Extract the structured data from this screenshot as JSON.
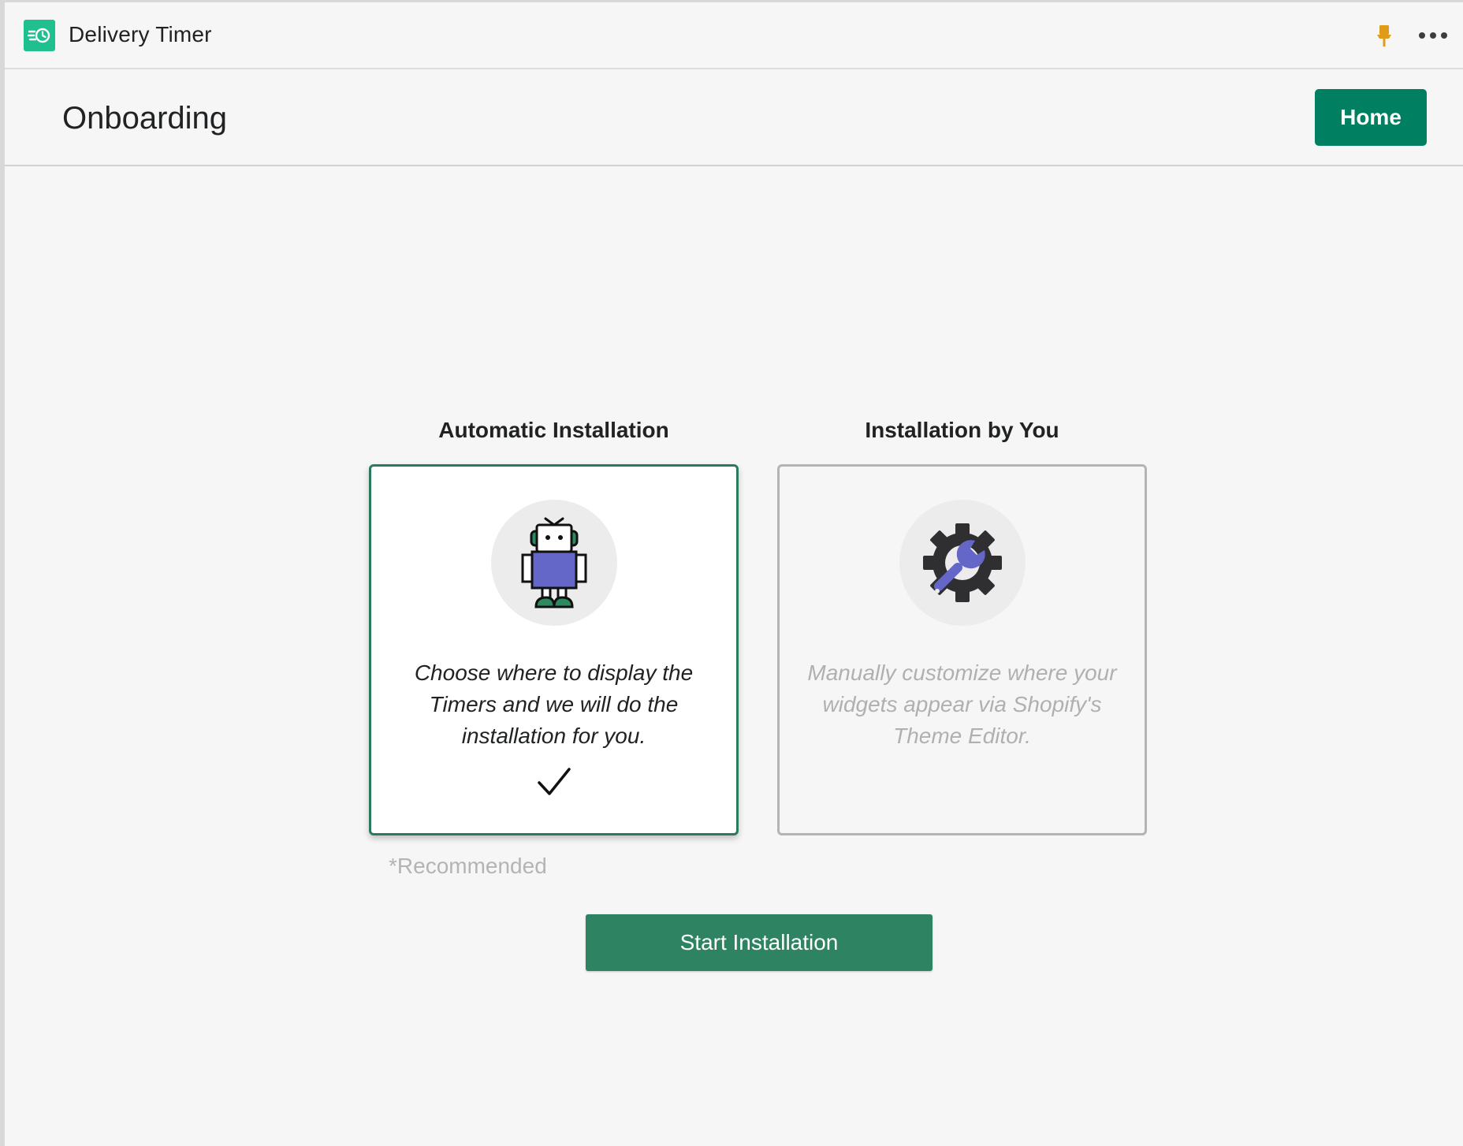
{
  "app": {
    "title": "Delivery Timer",
    "logo_icon": "delivery-timer-logo-icon",
    "brand_color": "#1fbf8f",
    "actions": {
      "pin_icon": "pin-icon",
      "more_icon": "more-actions-icon"
    }
  },
  "page": {
    "title": "Onboarding",
    "home_button_label": "Home",
    "primary_color": "#008060"
  },
  "options": [
    {
      "heading": "Automatic Installation",
      "description": "Choose where to display the Timers and we will do the installation for you.",
      "icon": "robot-icon",
      "selected": true
    },
    {
      "heading": "Installation by You",
      "description": "Manually customize where your widgets appear via Shopify's Theme Editor.",
      "icon": "gear-wrench-icon",
      "selected": false
    }
  ],
  "recommended_note": "*Recommended",
  "start_button_label": "Start Installation"
}
